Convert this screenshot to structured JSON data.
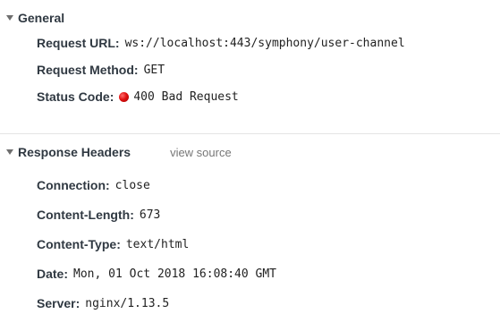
{
  "general": {
    "title": "General",
    "request_url": {
      "key": "Request URL",
      "value": "ws://localhost:443/symphony/user-channel"
    },
    "request_method": {
      "key": "Request Method",
      "value": "GET"
    },
    "status_code": {
      "key": "Status Code",
      "value": "400 Bad Request",
      "status_color": "#e01010"
    }
  },
  "response_headers": {
    "title": "Response Headers",
    "view_source_label": "view source",
    "headers": [
      {
        "key": "Connection",
        "value": "close"
      },
      {
        "key": "Content-Length",
        "value": "673"
      },
      {
        "key": "Content-Type",
        "value": "text/html"
      },
      {
        "key": "Date",
        "value": "Mon, 01 Oct 2018 16:08:40 GMT"
      },
      {
        "key": "Server",
        "value": "nginx/1.13.5"
      }
    ]
  }
}
